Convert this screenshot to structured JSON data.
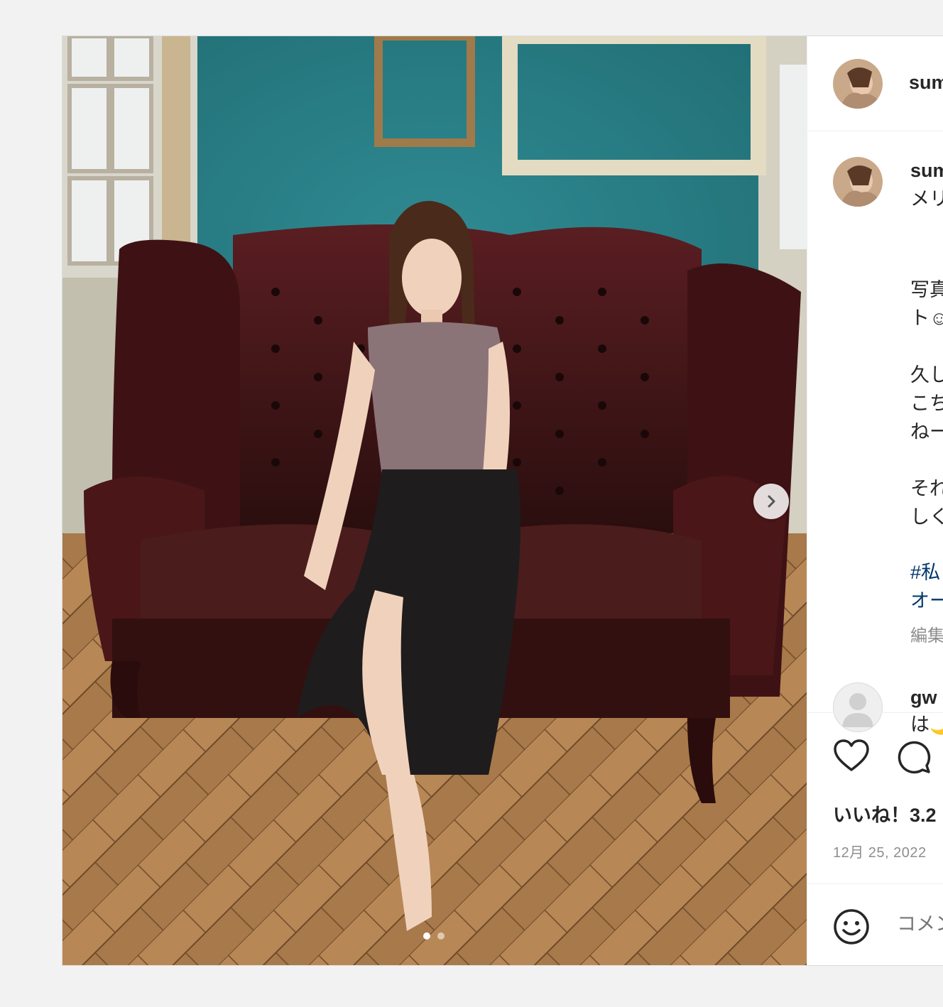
{
  "header": {
    "username": "sum"
  },
  "caption": {
    "username": "sum",
    "lines": [
      "メリ",
      "写真",
      "ト☺",
      "久し",
      "こち",
      "ねー",
      "それ",
      "しく"
    ],
    "hashtag_line_1": "#私",
    "hashtag_line_2": "オー",
    "edited_label": "編集"
  },
  "comment": {
    "username": "gw",
    "text": "は🌙"
  },
  "actions": {
    "like_icon": "heart-icon",
    "comment_icon": "comment-icon",
    "likes_text": "いいね！3.2",
    "date_text": "12月 25, 2022"
  },
  "add_comment": {
    "emoji_icon": "smiley-icon",
    "placeholder": "コメン"
  },
  "carousel": {
    "next_icon": "chevron-right-icon",
    "slides_total": 2,
    "current_slide": 1
  },
  "colors": {
    "wall": "#2f7f86",
    "sofa": "#3a1616",
    "floor": "#a8794a",
    "hashtag": "#00376b",
    "text": "#262626",
    "muted": "#8e8e8e"
  }
}
